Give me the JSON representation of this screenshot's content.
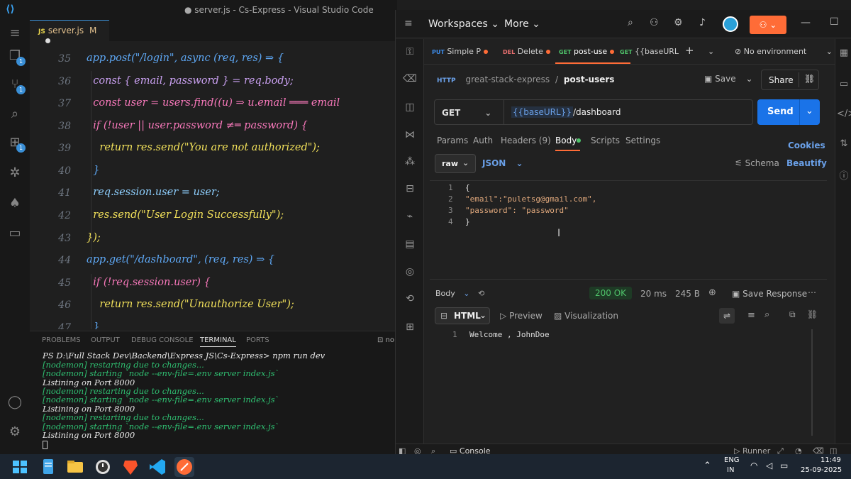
{
  "vscode": {
    "title": "● server.js - Cs-Express - Visual Studio Code",
    "tab": {
      "icon": "JS",
      "name": "server.js",
      "status": "M"
    },
    "line_numbers": [
      "35",
      "36",
      "37",
      "38",
      "39",
      "40",
      "41",
      "42",
      "43",
      "44",
      "45",
      "46",
      "47"
    ],
    "code_lines": [
      "app.post(\"/login\", async (req, res) ⇒ {",
      "  const { email, password } = req.body;",
      "  const user = users.find((u) ⇒ u.email ═══ email",
      "  if (!user || user.password ≠═ password) {",
      "    return res.send(\"You are not authorized\");",
      "  }",
      "  req.session.user = user;",
      "  res.send(\"User Login Successfully\");",
      "});",
      "app.get(\"/dashboard\", (req, res) ⇒ {",
      "  if (!req.session.user) {",
      "    return res.send(\"Unauthorize User\");",
      "  }"
    ],
    "panel_tabs": [
      "PROBLEMS",
      "OUTPUT",
      "DEBUG CONSOLE",
      "TERMINAL",
      "PORTS"
    ],
    "terminal_lines": [
      "PS D:\\Full Stack Dev\\Backend\\Express JS\\Cs-Express> npm run dev",
      "[nodemon] restarting due to changes...",
      "[nodemon] starting `node --env-file=.env server index.js`",
      "Listining on Port 8000",
      "[nodemon] restarting due to changes...",
      "[nodemon] starting `node --env-file=.env server index.js`",
      "Listining on Port 8000",
      "[nodemon] restarting due to changes...",
      "[nodemon] starting `node --env-file=.env server index.js`",
      "Listining on Port 8000"
    ]
  },
  "postman": {
    "workspaces": "Workspaces",
    "more": "More",
    "tabs": [
      {
        "method": "PUT",
        "name": "Simple P"
      },
      {
        "method": "DEL",
        "name": "Delete"
      },
      {
        "method": "GET",
        "name": "post-use"
      },
      {
        "method": "GET",
        "name": "{{baseURL"
      }
    ],
    "environment": "No environment",
    "breadcrumb_parent": "great-stack-express",
    "breadcrumb_sep": "/",
    "breadcrumb_current": "post-users",
    "save": "Save",
    "share": "Share",
    "method": "GET",
    "url_var": "{{baseURL}}",
    "url_path": "/dashboard",
    "send": "Send",
    "req_tabs": [
      "Params",
      "Auth",
      "Headers (9)",
      "Body",
      "Scripts",
      "Settings"
    ],
    "cookies": "Cookies",
    "body_mode": "raw",
    "body_lang": "JSON",
    "schema": "Schema",
    "beautify": "Beautify",
    "body_lines": [
      {
        "n": "1",
        "text": "{"
      },
      {
        "n": "2",
        "text": "\"email\":\"puletsg@gmail.com\","
      },
      {
        "n": "3",
        "text": "\"password\": \"password\""
      },
      {
        "n": "4",
        "text": "}"
      }
    ],
    "response_label": "Body",
    "status": "200 OK",
    "time": "20 ms",
    "size": "245 B",
    "save_response": "Save Response",
    "view_mode": "HTML",
    "preview": "Preview",
    "visualization": "Visualization",
    "response_lines": [
      {
        "n": "1",
        "text": "Welcome , JohnDoe"
      }
    ],
    "runner": "Runner",
    "console": "Console"
  },
  "taskbar": {
    "lang1": "ENG",
    "lang2": "IN",
    "time": "11:49",
    "date": "25-09-2025"
  }
}
